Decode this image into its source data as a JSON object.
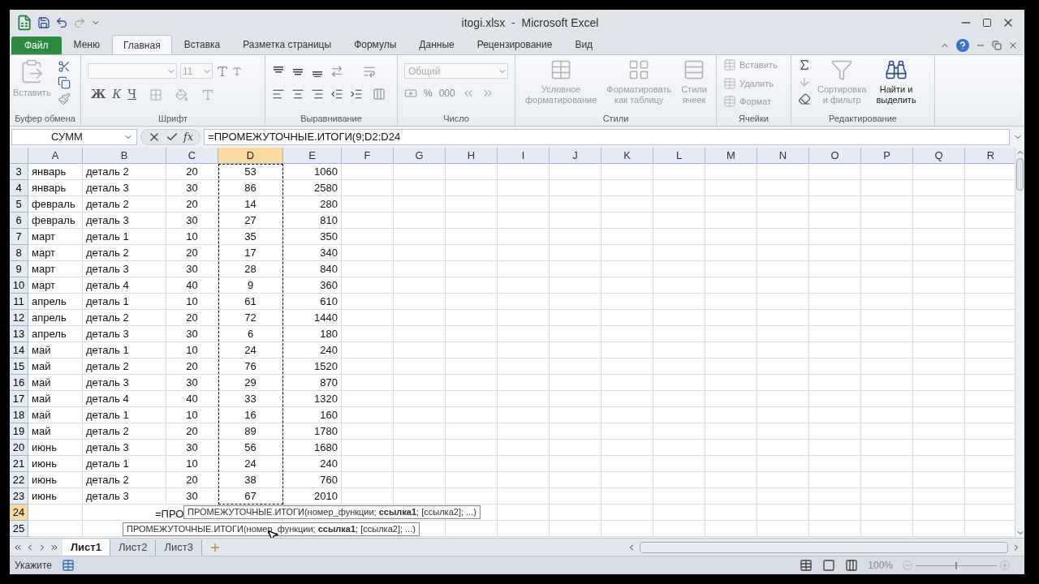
{
  "window": {
    "title": "itogi.xlsx  -  Microsoft Excel"
  },
  "tabs": [
    {
      "label": "Файл",
      "kind": "file",
      "selected": false
    },
    {
      "label": "Меню",
      "kind": "tab",
      "selected": false
    },
    {
      "label": "Главная",
      "kind": "tab",
      "selected": true
    },
    {
      "label": "Вставка",
      "kind": "tab",
      "selected": false
    },
    {
      "label": "Разметка страницы",
      "kind": "tab",
      "selected": false
    },
    {
      "label": "Формулы",
      "kind": "tab",
      "selected": false
    },
    {
      "label": "Данные",
      "kind": "tab",
      "selected": false
    },
    {
      "label": "Рецензирование",
      "kind": "tab",
      "selected": false
    },
    {
      "label": "Вид",
      "kind": "tab",
      "selected": false
    }
  ],
  "ribbon": {
    "groups": [
      {
        "kind": "clipboard",
        "label": "Буфер обмена",
        "paste": "Вставить"
      },
      {
        "kind": "font",
        "label": "Шрифт",
        "font_size": "11",
        "buttons": [
          "Ж",
          "К",
          "Ч"
        ]
      },
      {
        "kind": "alignment",
        "label": "Выравнивание"
      },
      {
        "kind": "number",
        "label": "Число",
        "format": "Общий",
        "buttons": [
          "%",
          "000"
        ]
      },
      {
        "kind": "styles",
        "label": "Стили",
        "buttons": [
          {
            "lines": [
              "Условное",
              "форматирование"
            ]
          },
          {
            "lines": [
              "Форматировать",
              "как таблицу"
            ]
          },
          {
            "lines": [
              "Стили",
              "ячеек"
            ]
          }
        ]
      },
      {
        "kind": "cells",
        "label": "Ячейки",
        "buttons": [
          "Вставить",
          "Удалить",
          "Формат"
        ]
      },
      {
        "kind": "editing",
        "label": "Редактирование",
        "buttons": [
          {
            "lines": [
              "Сортировка",
              "и фильтр"
            ],
            "disabled": true
          },
          {
            "lines": [
              "Найти и",
              "выделить"
            ],
            "disabled": false
          }
        ]
      }
    ]
  },
  "formula_bar": {
    "name_box": "СУММ",
    "function_button": "fx",
    "formula": "=ПРОМЕЖУТОЧНЫЕ.ИТОГИ(9;D2:D24"
  },
  "grid": {
    "columns": [
      {
        "label": "A",
        "selected": false
      },
      {
        "label": "B",
        "selected": false
      },
      {
        "label": "C",
        "selected": false
      },
      {
        "label": "D",
        "selected": true
      },
      {
        "label": "E",
        "selected": false
      },
      {
        "label": "F",
        "selected": false
      },
      {
        "label": "G",
        "selected": false
      },
      {
        "label": "H",
        "selected": false
      },
      {
        "label": "I",
        "selected": false
      },
      {
        "label": "J",
        "selected": false
      },
      {
        "label": "K",
        "selected": false
      },
      {
        "label": "L",
        "selected": false
      },
      {
        "label": "M",
        "selected": false
      },
      {
        "label": "N",
        "selected": false
      },
      {
        "label": "O",
        "selected": false
      },
      {
        "label": "P",
        "selected": false
      },
      {
        "label": "Q",
        "selected": false
      },
      {
        "label": "R",
        "selected": false
      }
    ],
    "rows": [
      {
        "header": "3",
        "selected": false,
        "cells": [
          "январь",
          "деталь 2",
          "20",
          "53",
          "1060"
        ]
      },
      {
        "header": "4",
        "selected": false,
        "cells": [
          "январь",
          "деталь 3",
          "30",
          "86",
          "2580"
        ]
      },
      {
        "header": "5",
        "selected": false,
        "cells": [
          "февраль",
          "деталь 2",
          "20",
          "14",
          "280"
        ]
      },
      {
        "header": "6",
        "selected": false,
        "cells": [
          "февраль",
          "деталь 3",
          "30",
          "27",
          "810"
        ]
      },
      {
        "header": "7",
        "selected": false,
        "cells": [
          "март",
          "деталь 1",
          "10",
          "35",
          "350"
        ]
      },
      {
        "header": "8",
        "selected": false,
        "cells": [
          "март",
          "деталь 2",
          "20",
          "17",
          "340"
        ]
      },
      {
        "header": "9",
        "selected": false,
        "cells": [
          "март",
          "деталь 3",
          "30",
          "28",
          "840"
        ]
      },
      {
        "header": "10",
        "selected": false,
        "cells": [
          "март",
          "деталь 4",
          "40",
          "9",
          "360"
        ]
      },
      {
        "header": "11",
        "selected": false,
        "cells": [
          "апрель",
          "деталь 1",
          "10",
          "61",
          "610"
        ]
      },
      {
        "header": "12",
        "selected": false,
        "cells": [
          "апрель",
          "деталь 2",
          "20",
          "72",
          "1440"
        ]
      },
      {
        "header": "13",
        "selected": false,
        "cells": [
          "апрель",
          "деталь 3",
          "30",
          "6",
          "180"
        ]
      },
      {
        "header": "14",
        "selected": false,
        "cells": [
          "май",
          "деталь 1",
          "10",
          "24",
          "240"
        ]
      },
      {
        "header": "15",
        "selected": false,
        "cells": [
          "май",
          "деталь 2",
          "20",
          "76",
          "1520"
        ]
      },
      {
        "header": "16",
        "selected": false,
        "cells": [
          "май",
          "деталь 3",
          "30",
          "29",
          "870"
        ]
      },
      {
        "header": "17",
        "selected": false,
        "cells": [
          "май",
          "деталь 4",
          "40",
          "33",
          "1320"
        ]
      },
      {
        "header": "18",
        "selected": false,
        "cells": [
          "май",
          "деталь 1",
          "10",
          "16",
          "160"
        ]
      },
      {
        "header": "19",
        "selected": false,
        "cells": [
          "май",
          "деталь 2",
          "20",
          "89",
          "1780"
        ]
      },
      {
        "header": "20",
        "selected": false,
        "cells": [
          "июнь",
          "деталь 3",
          "30",
          "56",
          "1680"
        ]
      },
      {
        "header": "21",
        "selected": false,
        "cells": [
          "июнь",
          "деталь 1",
          "10",
          "24",
          "240"
        ]
      },
      {
        "header": "22",
        "selected": false,
        "cells": [
          "июнь",
          "деталь 2",
          "20",
          "38",
          "760"
        ]
      },
      {
        "header": "23",
        "selected": false,
        "cells": [
          "июнь",
          "деталь 3",
          "30",
          "67",
          "2010"
        ]
      },
      {
        "header": "24",
        "selected": true,
        "entry": "=ПРО"
      },
      {
        "header": "25",
        "selected": false
      }
    ],
    "tooltips": [
      "ПРОМЕЖУТОЧНЫЕ.ИТОГИ(номер_функции; **ссылка1**; [ссылка2]; ...)",
      "ПРОМЕЖУТОЧНЫЕ.ИТОГИ(номер_функции; **ссылка1**; [ссылка2]; ...)"
    ]
  },
  "sheet_tabs": [
    {
      "label": "Лист1",
      "selected": true
    },
    {
      "label": "Лист2",
      "selected": false
    },
    {
      "label": "Лист3",
      "selected": false
    }
  ],
  "status_bar": {
    "mode": "Укажите",
    "zoom": "100%",
    "zoom_slider": {
      "level": 0.5
    }
  }
}
